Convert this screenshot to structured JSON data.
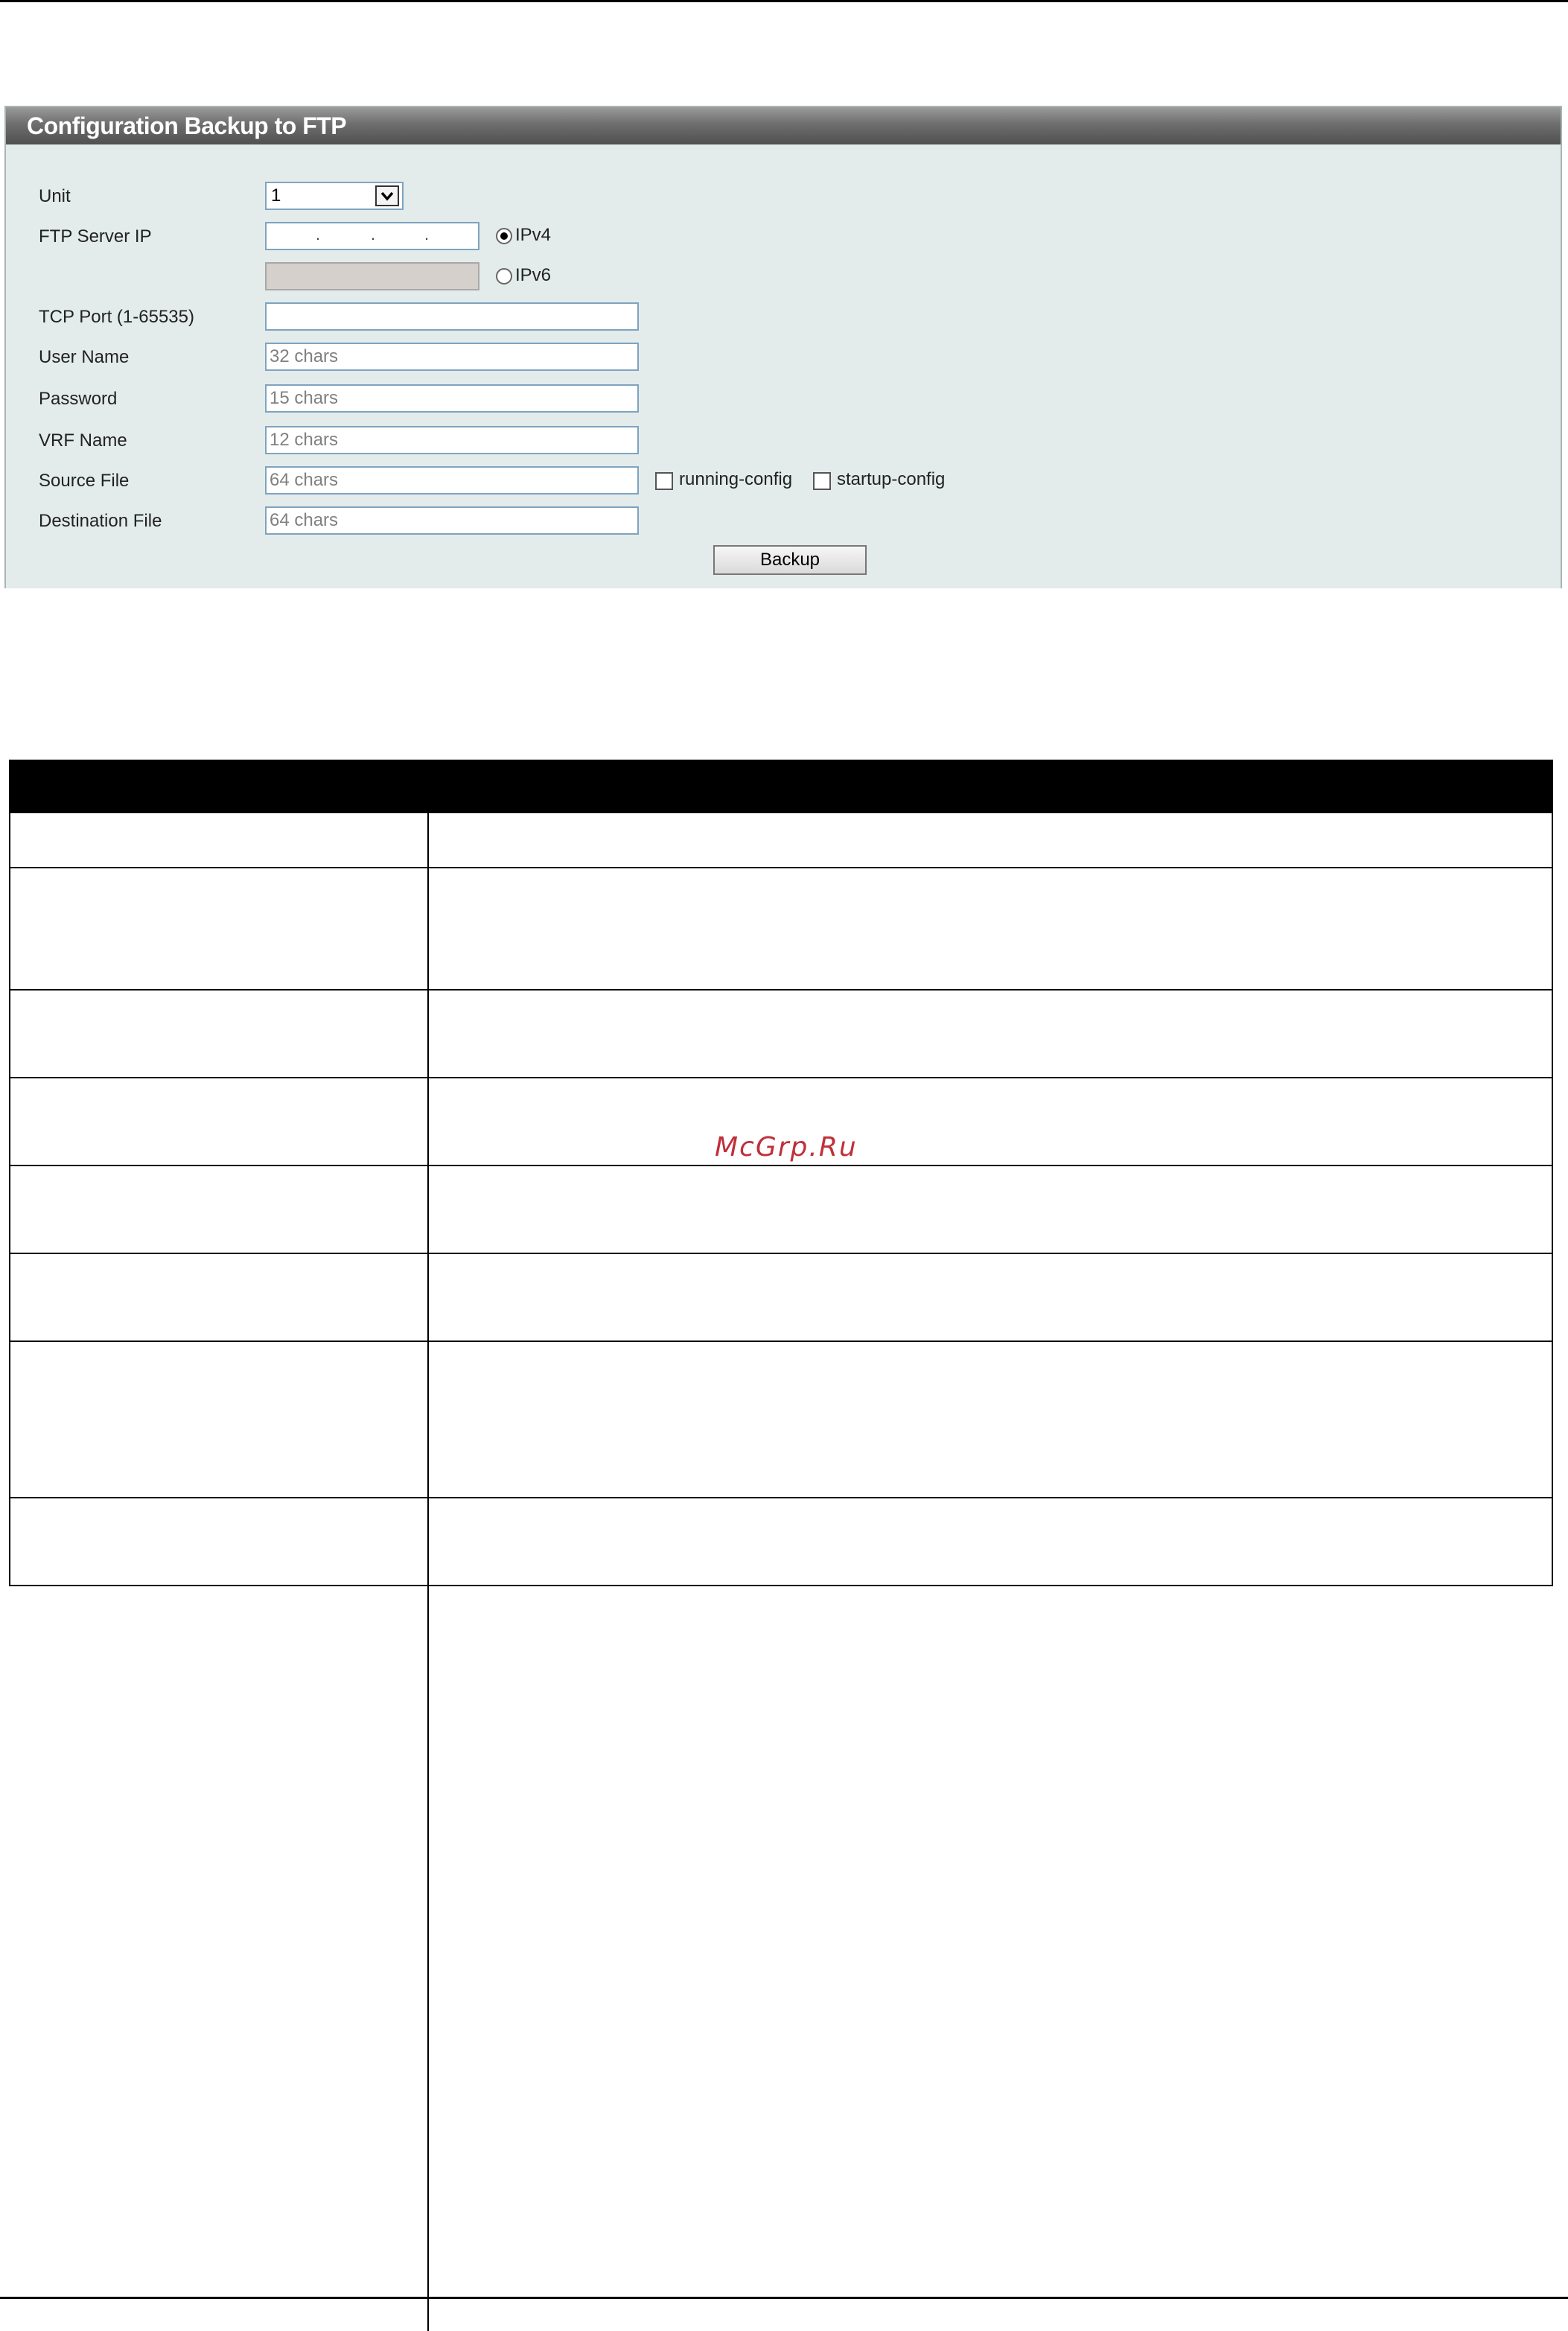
{
  "panel": {
    "title": "Configuration Backup to FTP",
    "unit": {
      "label": "Unit",
      "value": "1"
    },
    "ftp_server_ip": {
      "label": "FTP Server IP",
      "ipv4_option": "IPv4",
      "ipv6_option": "IPv6",
      "selected": "IPv4"
    },
    "tcp_port": {
      "label": "TCP Port (1-65535)",
      "value": ""
    },
    "user_name": {
      "label": "User Name",
      "placeholder": "32 chars"
    },
    "password": {
      "label": "Password",
      "placeholder": "15 chars"
    },
    "vrf_name": {
      "label": "VRF Name",
      "placeholder": "12 chars"
    },
    "source_file": {
      "label": "Source File",
      "placeholder": "64 chars",
      "option_running": "running-config",
      "option_startup": "startup-config"
    },
    "destination_file": {
      "label": "Destination File",
      "placeholder": "64 chars"
    },
    "backup_button": "Backup"
  },
  "watermark": "McGrp.Ru",
  "colors": {
    "title_bar": "#606060",
    "panel_bg": "#e3eceb",
    "field_border": "#7fa3c0"
  }
}
